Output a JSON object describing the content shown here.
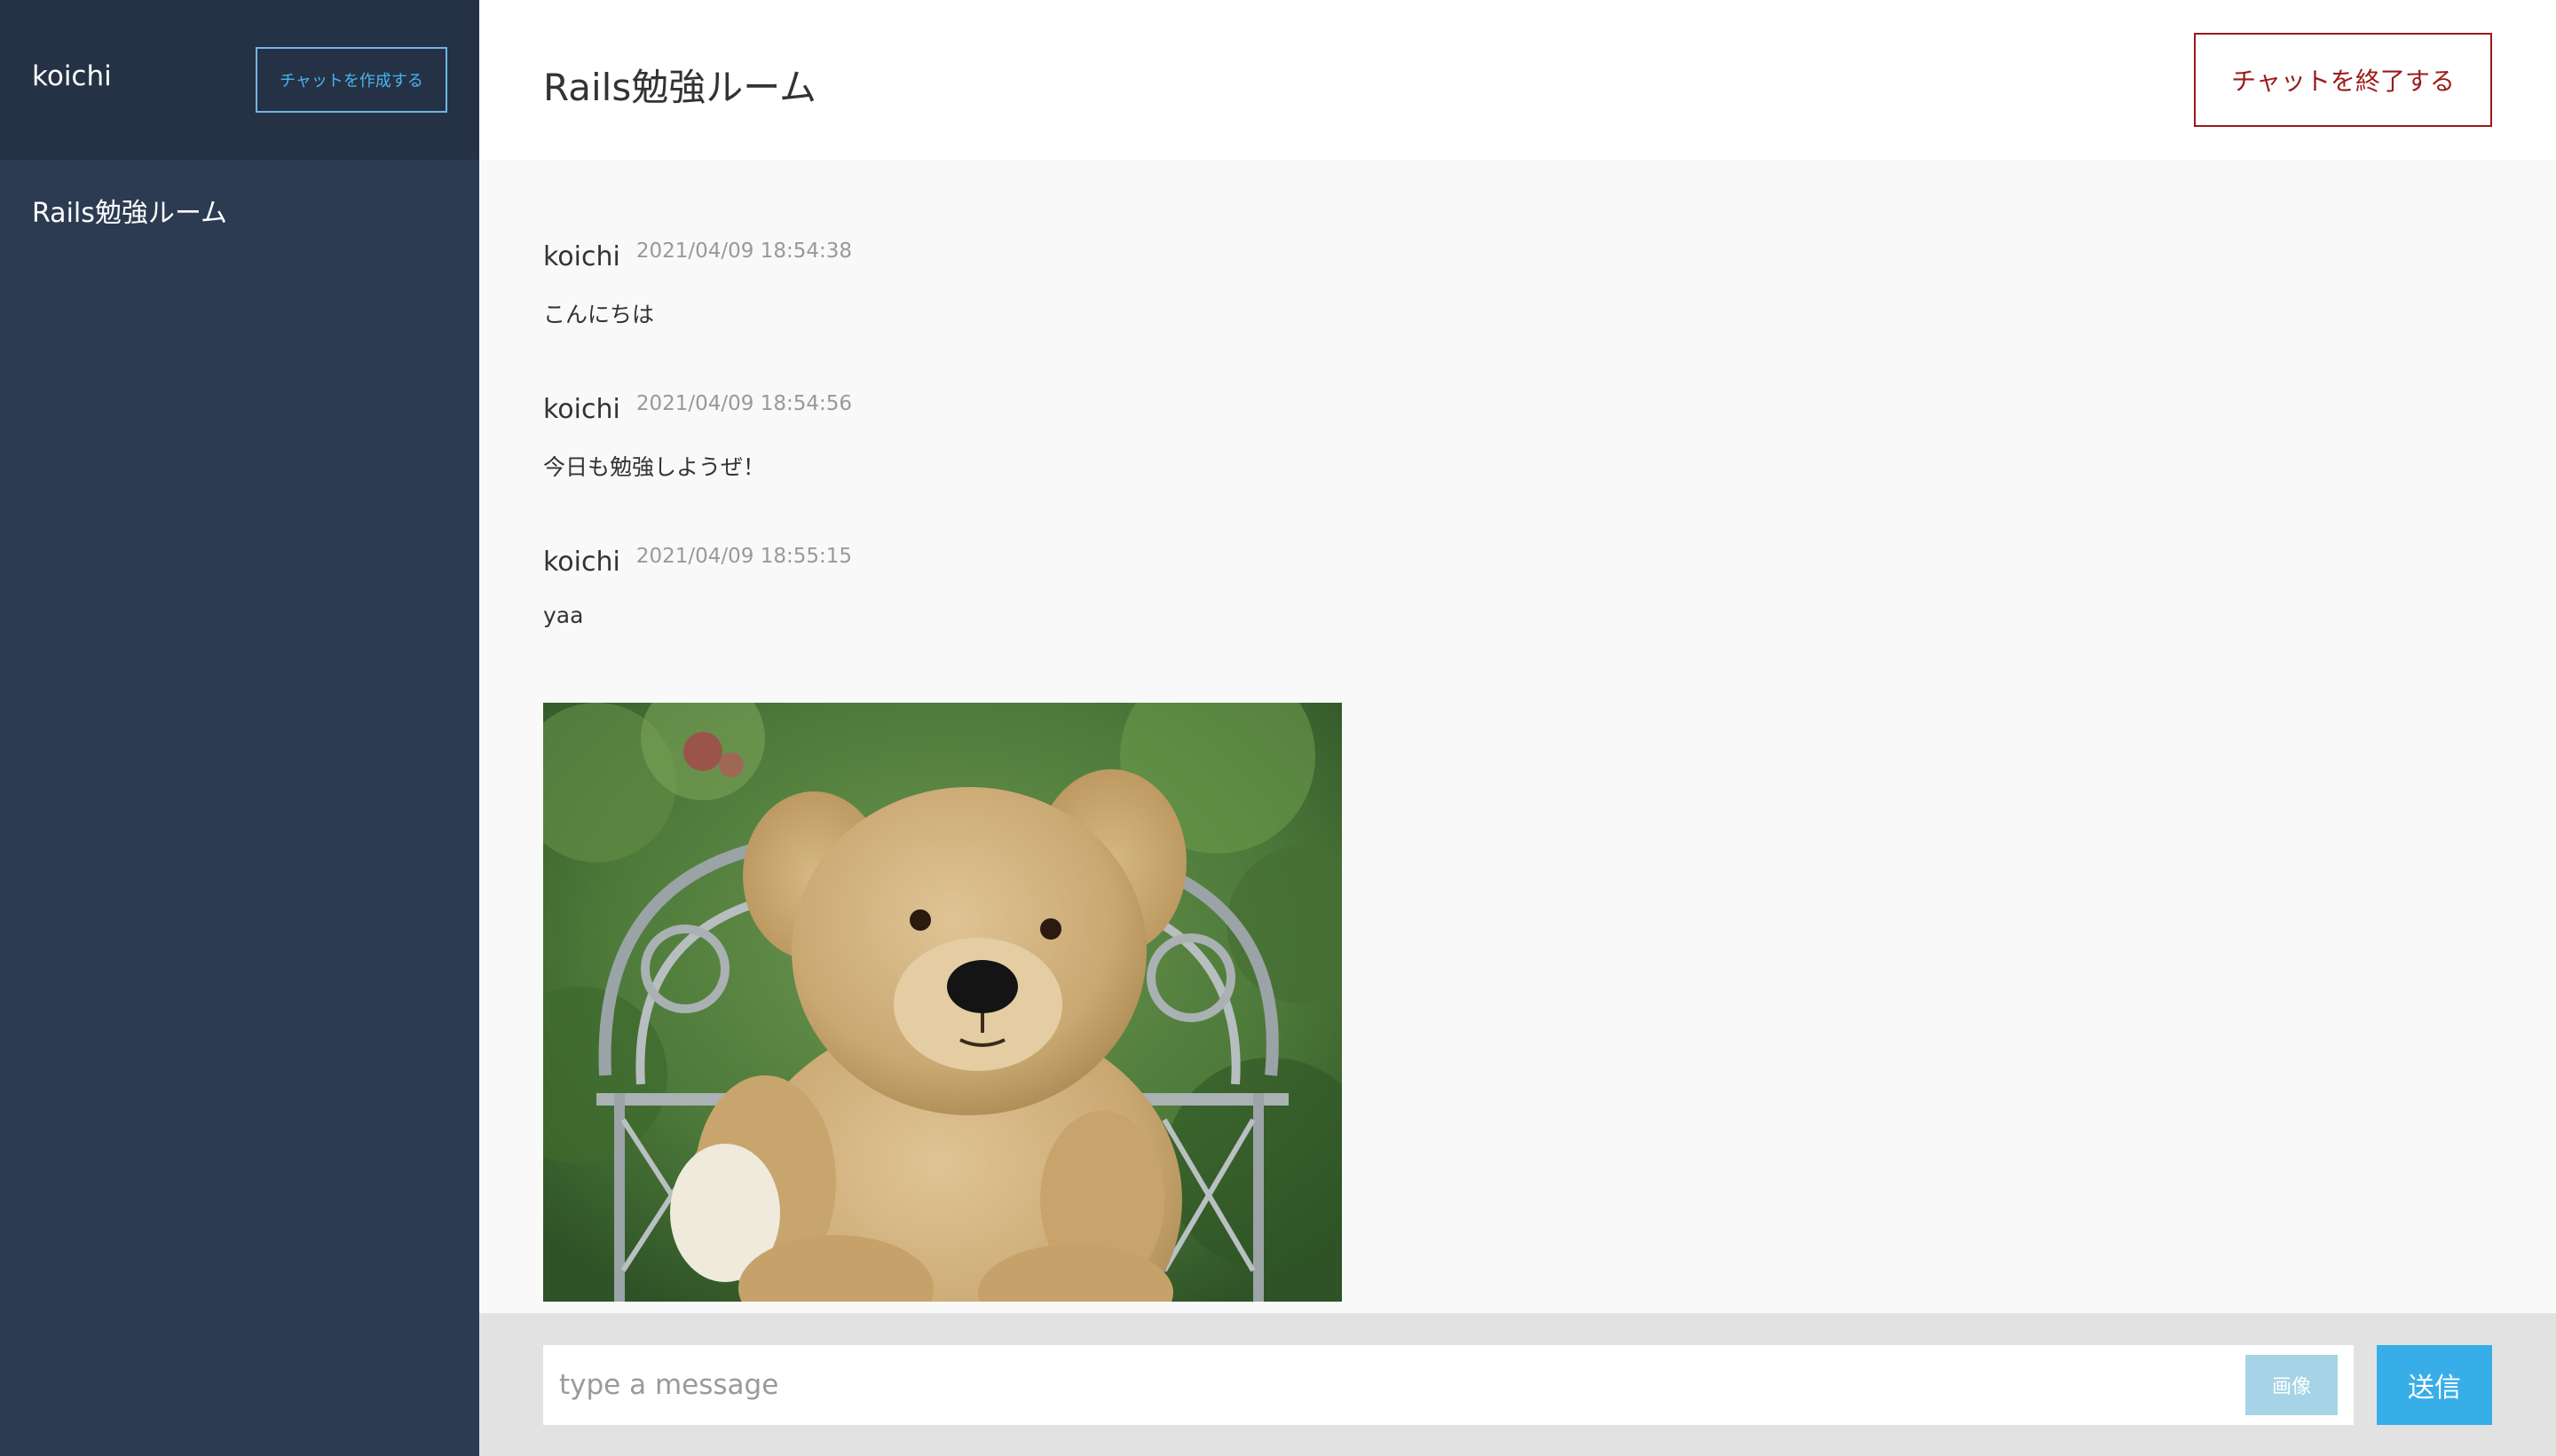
{
  "sidebar": {
    "user_name": "koichi",
    "create_chat_label": "チャットを作成する",
    "rooms": [
      {
        "label": "Rails勉強ルーム"
      }
    ]
  },
  "header": {
    "room_title": "Rails勉強ルーム",
    "end_chat_label": "チャットを終了する"
  },
  "messages": [
    {
      "user": "koichi",
      "time": "2021/04/09 18:54:38",
      "text": "こんにちは"
    },
    {
      "user": "koichi",
      "time": "2021/04/09 18:54:56",
      "text": "今日も勉強しようぜ！"
    },
    {
      "user": "koichi",
      "time": "2021/04/09 18:55:15",
      "text": "yaa"
    }
  ],
  "footer": {
    "input_placeholder": "type a message",
    "image_label": "画像",
    "send_label": "送信"
  },
  "colors": {
    "sidebar_bg": "#2c3b51",
    "sidebar_header_bg": "#253245",
    "accent_blue": "#38aee8",
    "end_button_red": "#9b1a1a"
  }
}
